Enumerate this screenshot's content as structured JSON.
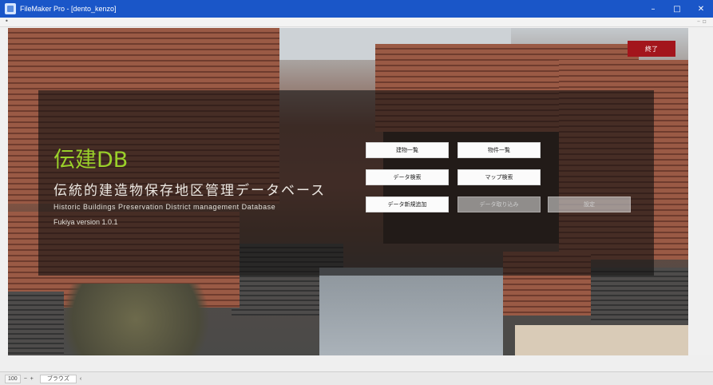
{
  "window": {
    "title": "FileMaker Pro - [dento_kenzo]",
    "minimize": "–",
    "maximize": "□",
    "close": "✕"
  },
  "menustrip": {
    "left_glyph": "•",
    "right_glyph": "– ▫"
  },
  "header": {
    "exit_label": "終了"
  },
  "branding": {
    "logo": "伝建DB",
    "subtitle_jp": "伝統的建造物保存地区管理データベース",
    "subtitle_en": "Historic Buildings Preservation District management Database",
    "version": "Fukiya version 1.0.1"
  },
  "buttons": {
    "building_list": "建物一覧",
    "property_list": "物件一覧",
    "data_search": "データ検索",
    "map_search": "マップ検索",
    "data_new": "データ新規追加",
    "data_import": "データ取り込み",
    "settings": "設定"
  },
  "statusbar": {
    "zoom": "100",
    "zoom_minus": "−",
    "zoom_plus": "+",
    "mode": "ブラウズ",
    "arrow": "‹"
  }
}
